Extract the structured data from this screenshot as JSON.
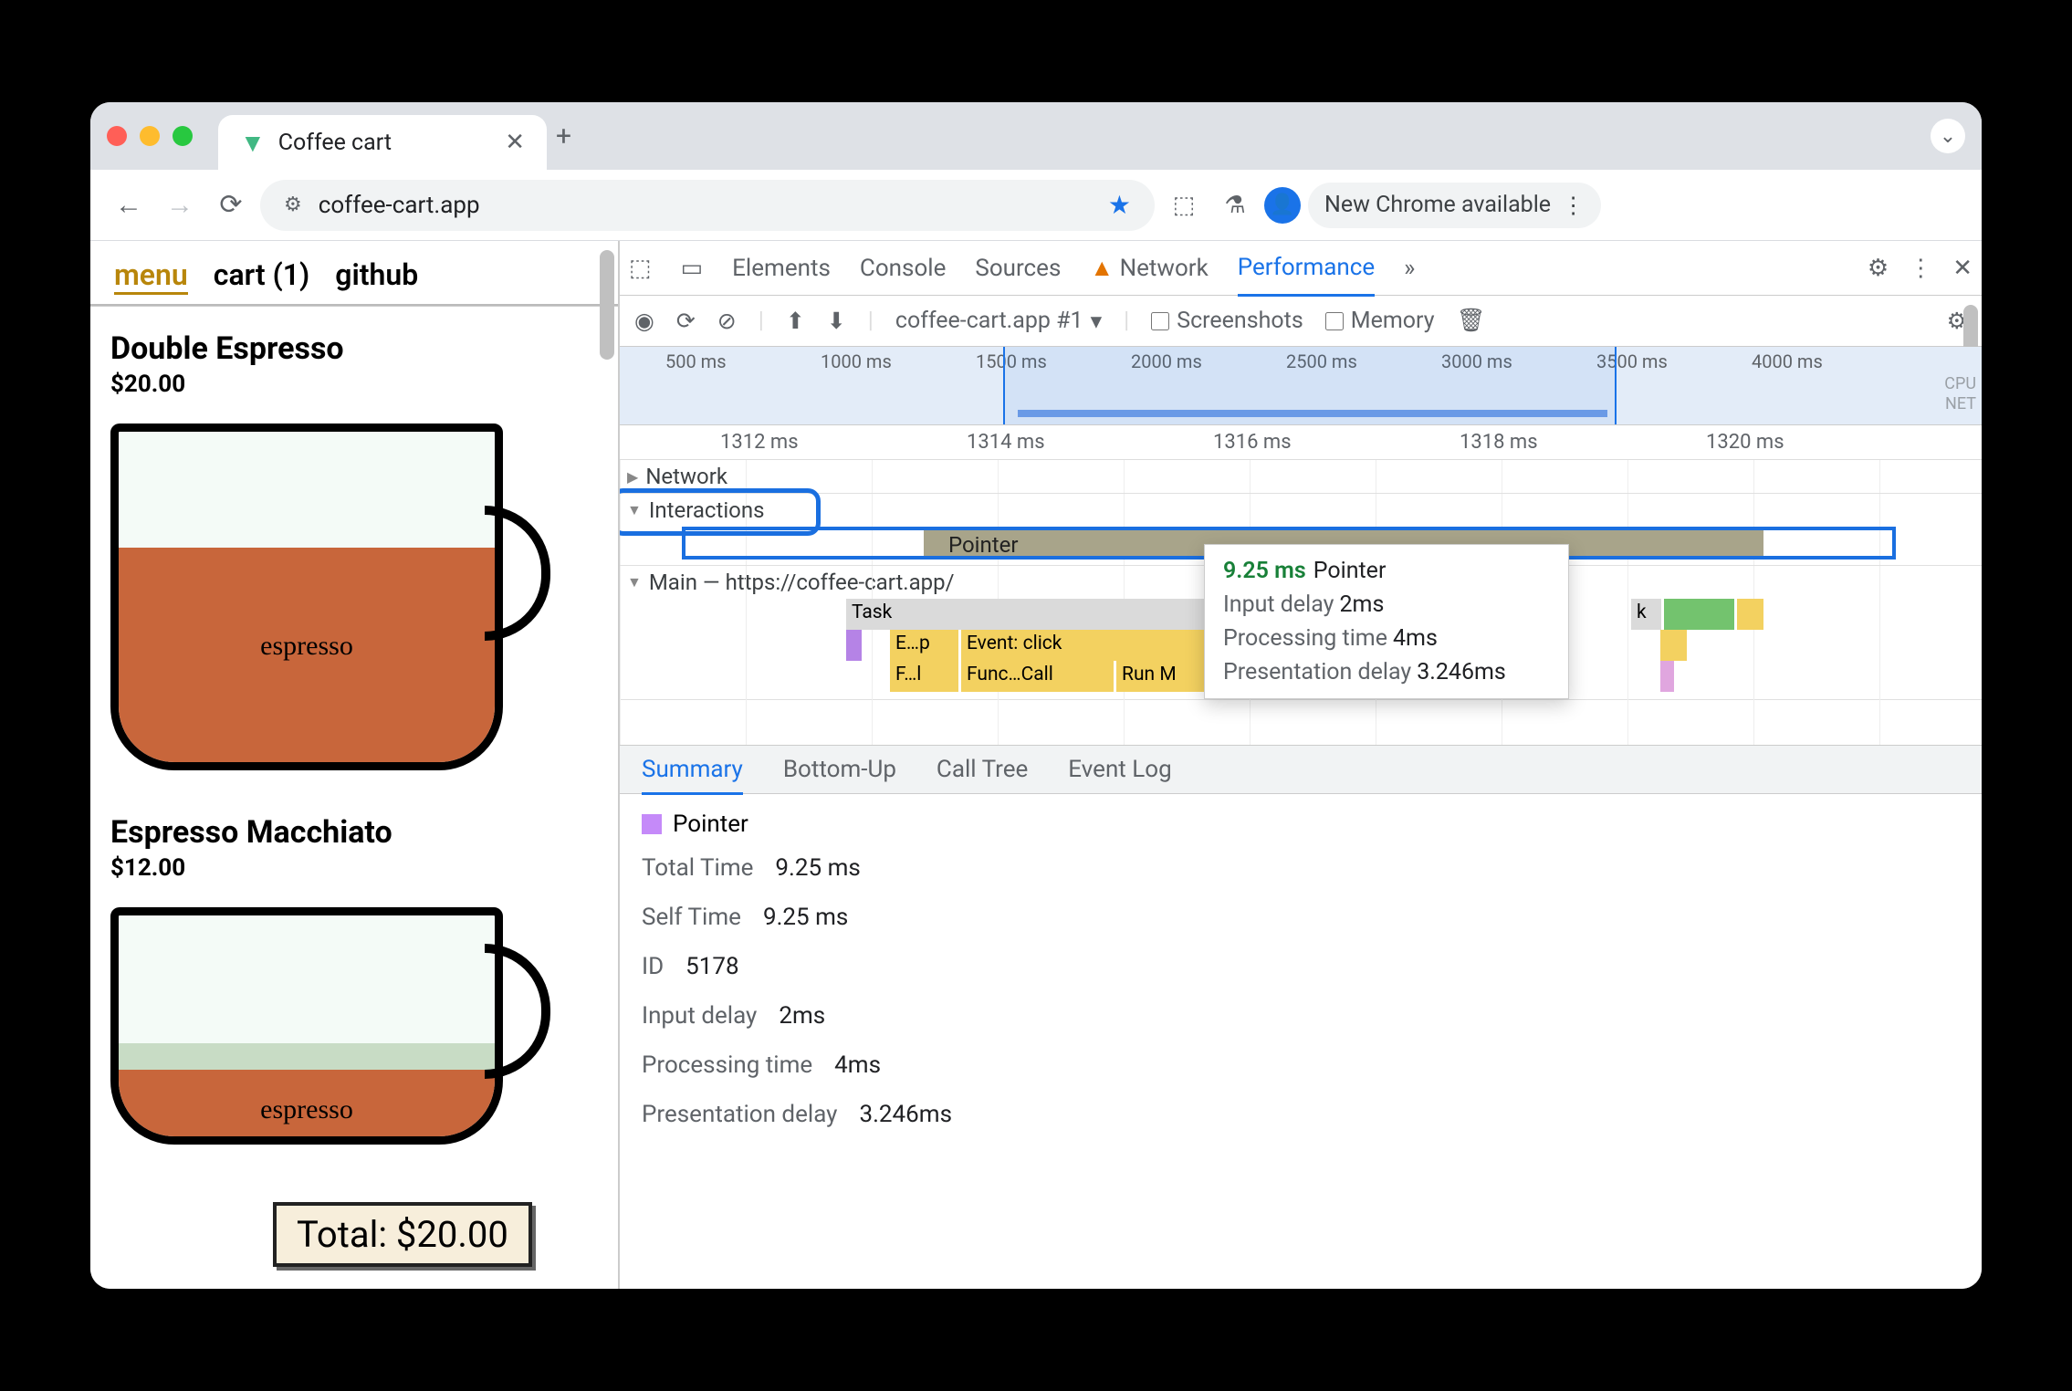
{
  "browser": {
    "tab_title": "Coffee cart",
    "url": "coffee-cart.app",
    "new_chrome": "New Chrome available"
  },
  "app": {
    "nav": {
      "menu": "menu",
      "cart": "cart (1)",
      "github": "github"
    },
    "products": [
      {
        "name": "Double Espresso",
        "price": "$20.00",
        "label": "espresso",
        "fill_pct": 65
      },
      {
        "name": "Espresso Macchiato",
        "price": "$12.00",
        "label": "espresso",
        "fill_pct": 40,
        "foam_pct": 12
      }
    ],
    "total": "Total: $20.00"
  },
  "devtools": {
    "tabs": {
      "elements": "Elements",
      "console": "Console",
      "sources": "Sources",
      "network": "Network",
      "performance": "Performance"
    },
    "perf_toolbar": {
      "selector": "coffee-cart.app #1",
      "screenshots": "Screenshots",
      "memory": "Memory"
    },
    "overview": {
      "ticks": [
        "500 ms",
        "1000 ms",
        "1500 ms",
        "2000 ms",
        "2500 ms",
        "3000 ms",
        "3500 ms",
        "4000 ms"
      ],
      "labels": [
        "CPU",
        "NET"
      ]
    },
    "flame": {
      "ticks": [
        "1312 ms",
        "1314 ms",
        "1316 ms",
        "1318 ms",
        "1320 ms"
      ],
      "network": "Network",
      "interactions": "Interactions",
      "interaction_label": "Pointer",
      "main": "Main — https://coffee-cart.app/",
      "tasks": {
        "row1": [
          "Task",
          "k"
        ],
        "row2": [
          "E…p",
          "Event: click"
        ],
        "row3": [
          "F…l",
          "Func…Call",
          "Run M"
        ]
      }
    },
    "tooltip": {
      "dur": "9.25 ms",
      "type": "Pointer",
      "input_delay_l": "Input delay",
      "input_delay": "2ms",
      "proc_l": "Processing time",
      "proc": "4ms",
      "pres_l": "Presentation delay",
      "pres": "3.246ms"
    },
    "summary_tabs": {
      "summary": "Summary",
      "bottomup": "Bottom-Up",
      "calltree": "Call Tree",
      "eventlog": "Event Log"
    },
    "summary": {
      "title": "Pointer",
      "rows": [
        {
          "l": "Total Time",
          "v": "9.25 ms"
        },
        {
          "l": "Self Time",
          "v": "9.25 ms"
        },
        {
          "l": "ID",
          "v": "5178"
        },
        {
          "l": "Input delay",
          "v": "2ms"
        },
        {
          "l": "Processing time",
          "v": "4ms"
        },
        {
          "l": "Presentation delay",
          "v": "3.246ms"
        }
      ]
    }
  }
}
